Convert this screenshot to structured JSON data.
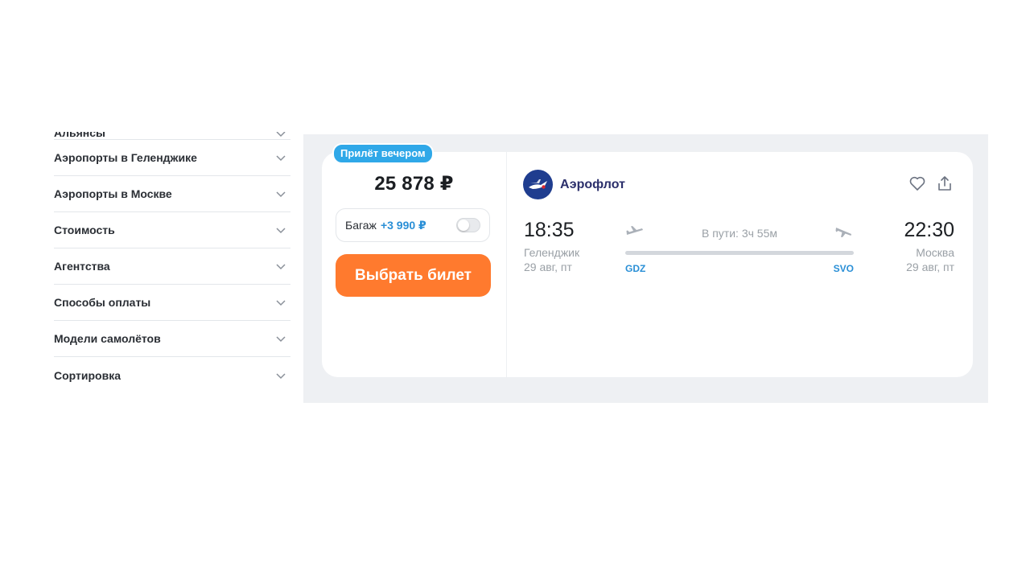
{
  "sidebar": {
    "items": [
      {
        "label": "Альянсы"
      },
      {
        "label": "Аэропорты в Геленджике"
      },
      {
        "label": "Аэропорты в Москве"
      },
      {
        "label": "Стоимость"
      },
      {
        "label": "Агентства"
      },
      {
        "label": "Способы оплаты"
      },
      {
        "label": "Модели самолётов"
      },
      {
        "label": "Сортировка"
      }
    ]
  },
  "ticket": {
    "badge": "Прилёт вечером",
    "price": "25 878 ₽",
    "baggage": {
      "label": "Багаж",
      "price": "+3 990 ₽",
      "enabled": false
    },
    "buy_button": "Выбрать билет",
    "airline": {
      "name": "Аэрофлот",
      "logo_icon": "aeroflot-logo-icon"
    },
    "departure": {
      "time": "18:35",
      "city": "Геленджик",
      "date": "29 авг, пт",
      "iata": "GDZ"
    },
    "arrival": {
      "time": "22:30",
      "city": "Москва",
      "date": "29 авг, пт",
      "iata": "SVO"
    },
    "duration": "В пути: 3ч 55м"
  },
  "colors": {
    "accent_button": "#ff7a2e",
    "badge": "#2fa8e8",
    "link_blue": "#2a8fd6",
    "airline_text": "#2b2f6b",
    "panel_bg": "#eef0f3"
  }
}
